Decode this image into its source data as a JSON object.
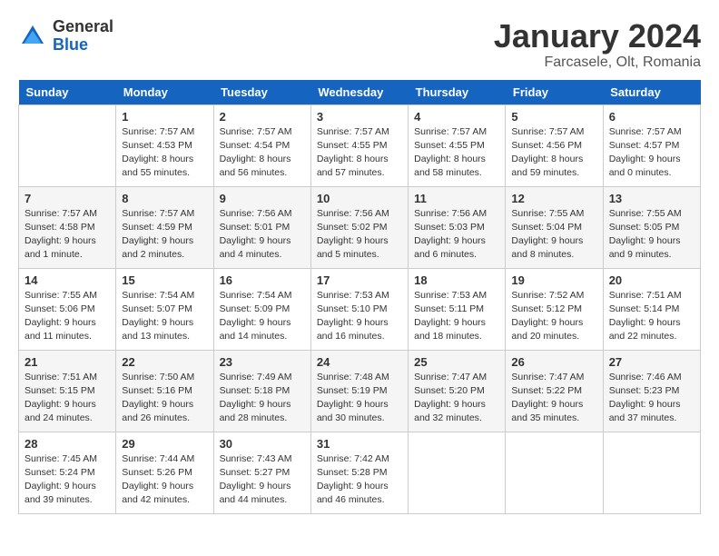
{
  "header": {
    "logo_general": "General",
    "logo_blue": "Blue",
    "month_title": "January 2024",
    "location": "Farcasele, Olt, Romania"
  },
  "weekdays": [
    "Sunday",
    "Monday",
    "Tuesday",
    "Wednesday",
    "Thursday",
    "Friday",
    "Saturday"
  ],
  "weeks": [
    [
      {
        "num": "",
        "info": ""
      },
      {
        "num": "1",
        "info": "Sunrise: 7:57 AM\nSunset: 4:53 PM\nDaylight: 8 hours\nand 55 minutes."
      },
      {
        "num": "2",
        "info": "Sunrise: 7:57 AM\nSunset: 4:54 PM\nDaylight: 8 hours\nand 56 minutes."
      },
      {
        "num": "3",
        "info": "Sunrise: 7:57 AM\nSunset: 4:55 PM\nDaylight: 8 hours\nand 57 minutes."
      },
      {
        "num": "4",
        "info": "Sunrise: 7:57 AM\nSunset: 4:55 PM\nDaylight: 8 hours\nand 58 minutes."
      },
      {
        "num": "5",
        "info": "Sunrise: 7:57 AM\nSunset: 4:56 PM\nDaylight: 8 hours\nand 59 minutes."
      },
      {
        "num": "6",
        "info": "Sunrise: 7:57 AM\nSunset: 4:57 PM\nDaylight: 9 hours\nand 0 minutes."
      }
    ],
    [
      {
        "num": "7",
        "info": "Sunrise: 7:57 AM\nSunset: 4:58 PM\nDaylight: 9 hours\nand 1 minute."
      },
      {
        "num": "8",
        "info": "Sunrise: 7:57 AM\nSunset: 4:59 PM\nDaylight: 9 hours\nand 2 minutes."
      },
      {
        "num": "9",
        "info": "Sunrise: 7:56 AM\nSunset: 5:01 PM\nDaylight: 9 hours\nand 4 minutes."
      },
      {
        "num": "10",
        "info": "Sunrise: 7:56 AM\nSunset: 5:02 PM\nDaylight: 9 hours\nand 5 minutes."
      },
      {
        "num": "11",
        "info": "Sunrise: 7:56 AM\nSunset: 5:03 PM\nDaylight: 9 hours\nand 6 minutes."
      },
      {
        "num": "12",
        "info": "Sunrise: 7:55 AM\nSunset: 5:04 PM\nDaylight: 9 hours\nand 8 minutes."
      },
      {
        "num": "13",
        "info": "Sunrise: 7:55 AM\nSunset: 5:05 PM\nDaylight: 9 hours\nand 9 minutes."
      }
    ],
    [
      {
        "num": "14",
        "info": "Sunrise: 7:55 AM\nSunset: 5:06 PM\nDaylight: 9 hours\nand 11 minutes."
      },
      {
        "num": "15",
        "info": "Sunrise: 7:54 AM\nSunset: 5:07 PM\nDaylight: 9 hours\nand 13 minutes."
      },
      {
        "num": "16",
        "info": "Sunrise: 7:54 AM\nSunset: 5:09 PM\nDaylight: 9 hours\nand 14 minutes."
      },
      {
        "num": "17",
        "info": "Sunrise: 7:53 AM\nSunset: 5:10 PM\nDaylight: 9 hours\nand 16 minutes."
      },
      {
        "num": "18",
        "info": "Sunrise: 7:53 AM\nSunset: 5:11 PM\nDaylight: 9 hours\nand 18 minutes."
      },
      {
        "num": "19",
        "info": "Sunrise: 7:52 AM\nSunset: 5:12 PM\nDaylight: 9 hours\nand 20 minutes."
      },
      {
        "num": "20",
        "info": "Sunrise: 7:51 AM\nSunset: 5:14 PM\nDaylight: 9 hours\nand 22 minutes."
      }
    ],
    [
      {
        "num": "21",
        "info": "Sunrise: 7:51 AM\nSunset: 5:15 PM\nDaylight: 9 hours\nand 24 minutes."
      },
      {
        "num": "22",
        "info": "Sunrise: 7:50 AM\nSunset: 5:16 PM\nDaylight: 9 hours\nand 26 minutes."
      },
      {
        "num": "23",
        "info": "Sunrise: 7:49 AM\nSunset: 5:18 PM\nDaylight: 9 hours\nand 28 minutes."
      },
      {
        "num": "24",
        "info": "Sunrise: 7:48 AM\nSunset: 5:19 PM\nDaylight: 9 hours\nand 30 minutes."
      },
      {
        "num": "25",
        "info": "Sunrise: 7:47 AM\nSunset: 5:20 PM\nDaylight: 9 hours\nand 32 minutes."
      },
      {
        "num": "26",
        "info": "Sunrise: 7:47 AM\nSunset: 5:22 PM\nDaylight: 9 hours\nand 35 minutes."
      },
      {
        "num": "27",
        "info": "Sunrise: 7:46 AM\nSunset: 5:23 PM\nDaylight: 9 hours\nand 37 minutes."
      }
    ],
    [
      {
        "num": "28",
        "info": "Sunrise: 7:45 AM\nSunset: 5:24 PM\nDaylight: 9 hours\nand 39 minutes."
      },
      {
        "num": "29",
        "info": "Sunrise: 7:44 AM\nSunset: 5:26 PM\nDaylight: 9 hours\nand 42 minutes."
      },
      {
        "num": "30",
        "info": "Sunrise: 7:43 AM\nSunset: 5:27 PM\nDaylight: 9 hours\nand 44 minutes."
      },
      {
        "num": "31",
        "info": "Sunrise: 7:42 AM\nSunset: 5:28 PM\nDaylight: 9 hours\nand 46 minutes."
      },
      {
        "num": "",
        "info": ""
      },
      {
        "num": "",
        "info": ""
      },
      {
        "num": "",
        "info": ""
      }
    ]
  ]
}
